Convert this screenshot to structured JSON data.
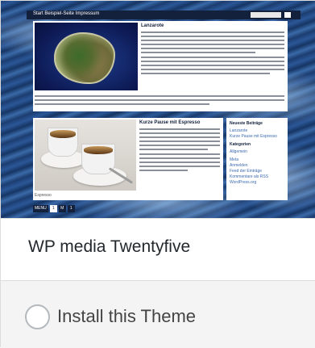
{
  "preview": {
    "topbar_text": "Start  Beispiel-Seite  Impressum",
    "post1_title": "Lanzarote",
    "post2_title": "Kurze Pause mit Espresso",
    "caption": "Espresso",
    "sidebar": {
      "heading1": "Neueste Beiträge",
      "heading2": "Kategorien",
      "links": [
        "Lanzarote",
        "Kurze Pause mit Espresso",
        "Allgemein",
        "Meta",
        "Anmelden",
        "Feed der Einträge",
        "Kommentare als RSS",
        "WordPress.org"
      ]
    },
    "pager": [
      "MENU",
      "1",
      "M",
      "1"
    ]
  },
  "theme": {
    "name": "WP media Twentyfive",
    "install_label": "Install this Theme"
  }
}
